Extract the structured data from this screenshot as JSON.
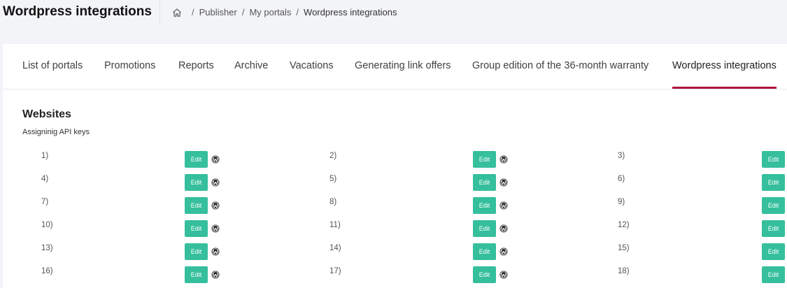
{
  "header": {
    "title": "Wordpress integrations",
    "breadcrumb": [
      {
        "label": "Publisher"
      },
      {
        "label": "My portals"
      },
      {
        "label": "Wordpress integrations"
      }
    ]
  },
  "tabs": [
    {
      "label": "List of portals"
    },
    {
      "label": "Promotions"
    },
    {
      "label": "Reports"
    },
    {
      "label": "Archive"
    },
    {
      "label": "Vacations"
    },
    {
      "label": "Generating link offers"
    },
    {
      "label": "Group edition of the 36-month warranty"
    },
    {
      "label": "Wordpress integrations",
      "active": true
    }
  ],
  "section": {
    "title": "Websites",
    "subtitle": "Assigninig API keys"
  },
  "edit_label": "Edit",
  "sites": [
    {
      "label": "1)"
    },
    {
      "label": "2)"
    },
    {
      "label": "3)"
    },
    {
      "label": "4)"
    },
    {
      "label": "5)"
    },
    {
      "label": "6)"
    },
    {
      "label": "7)"
    },
    {
      "label": "8)"
    },
    {
      "label": "9)"
    },
    {
      "label": "10)"
    },
    {
      "label": "11)"
    },
    {
      "label": "12)"
    },
    {
      "label": "13)"
    },
    {
      "label": "14)"
    },
    {
      "label": "15)"
    },
    {
      "label": "16)"
    },
    {
      "label": "17)"
    },
    {
      "label": "18)"
    }
  ],
  "colors": {
    "accent": "#b1153f",
    "edit_button": "#35bf9c",
    "background": "#f3f4f8"
  },
  "icons": {
    "breadcrumb_home": "home-icon",
    "site_platform": "wordpress-icon"
  }
}
